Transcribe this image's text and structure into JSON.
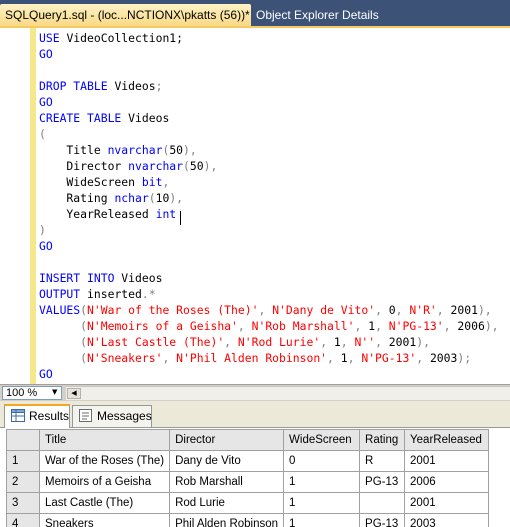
{
  "tabs": {
    "active_label": "SQLQuery1.sql - (loc...NCTIONX\\pkatts (56))*",
    "inactive_label": "Object Explorer Details"
  },
  "editor": {
    "lines": [
      {
        "row": 0,
        "segs": [
          [
            "kw",
            "USE "
          ],
          [
            "",
            "VideoCollection1;"
          ]
        ]
      },
      {
        "row": 1,
        "segs": [
          [
            "kw",
            "GO"
          ]
        ]
      },
      {
        "row": 3,
        "segs": [
          [
            "kw",
            "DROP TABLE "
          ],
          [
            "",
            "Videos"
          ],
          [
            "op",
            ";"
          ]
        ]
      },
      {
        "row": 4,
        "segs": [
          [
            "kw",
            "GO"
          ]
        ]
      },
      {
        "row": 5,
        "segs": [
          [
            "kw",
            "CREATE TABLE "
          ],
          [
            "",
            "Videos"
          ]
        ]
      },
      {
        "row": 6,
        "segs": [
          [
            "op",
            "("
          ]
        ]
      },
      {
        "row": 7,
        "segs": [
          [
            "",
            "    Title "
          ],
          [
            "kw",
            "nvarchar"
          ],
          [
            "op",
            "("
          ],
          [
            "",
            "50"
          ],
          [
            "op",
            "),"
          ]
        ]
      },
      {
        "row": 8,
        "segs": [
          [
            "",
            "    Director "
          ],
          [
            "kw",
            "nvarchar"
          ],
          [
            "op",
            "("
          ],
          [
            "",
            "50"
          ],
          [
            "op",
            "),"
          ]
        ]
      },
      {
        "row": 9,
        "segs": [
          [
            "",
            "    WideScreen "
          ],
          [
            "kw",
            "bit"
          ],
          [
            "op",
            ","
          ]
        ]
      },
      {
        "row": 10,
        "segs": [
          [
            "",
            "    Rating "
          ],
          [
            "kw",
            "nchar"
          ],
          [
            "op",
            "("
          ],
          [
            "",
            "10"
          ],
          [
            "op",
            "),"
          ]
        ]
      },
      {
        "row": 11,
        "segs": [
          [
            "",
            "    YearReleased "
          ],
          [
            "kw",
            "int"
          ]
        ]
      },
      {
        "row": 12,
        "segs": [
          [
            "op",
            ")"
          ]
        ]
      },
      {
        "row": 13,
        "segs": [
          [
            "kw",
            "GO"
          ]
        ]
      },
      {
        "row": 15,
        "segs": [
          [
            "kw",
            "INSERT INTO "
          ],
          [
            "",
            "Videos"
          ]
        ]
      },
      {
        "row": 16,
        "segs": [
          [
            "kw",
            "OUTPUT "
          ],
          [
            "",
            "inserted"
          ],
          [
            "op",
            ".*"
          ]
        ]
      },
      {
        "row": 17,
        "segs": [
          [
            "kw",
            "VALUES"
          ],
          [
            "op",
            "("
          ],
          [
            "str",
            "N'War of the Roses (The)'"
          ],
          [
            "op",
            ", "
          ],
          [
            "str",
            "N'Dany de Vito'"
          ],
          [
            "op",
            ", "
          ],
          [
            "",
            "0"
          ],
          [
            "op",
            ", "
          ],
          [
            "str",
            "N'R'"
          ],
          [
            "op",
            ", "
          ],
          [
            "",
            "2001"
          ],
          [
            "op",
            "),"
          ]
        ]
      },
      {
        "row": 18,
        "segs": [
          [
            "",
            "      "
          ],
          [
            "op",
            "("
          ],
          [
            "str",
            "N'Memoirs of a Geisha'"
          ],
          [
            "op",
            ", "
          ],
          [
            "str",
            "N'Rob Marshall'"
          ],
          [
            "op",
            ", "
          ],
          [
            "",
            "1"
          ],
          [
            "op",
            ", "
          ],
          [
            "str",
            "N'PG-13'"
          ],
          [
            "op",
            ", "
          ],
          [
            "",
            "2006"
          ],
          [
            "op",
            "),"
          ]
        ]
      },
      {
        "row": 19,
        "segs": [
          [
            "",
            "      "
          ],
          [
            "op",
            "("
          ],
          [
            "str",
            "N'Last Castle (The)'"
          ],
          [
            "op",
            ", "
          ],
          [
            "str",
            "N'Rod Lurie'"
          ],
          [
            "op",
            ", "
          ],
          [
            "",
            "1"
          ],
          [
            "op",
            ", "
          ],
          [
            "str",
            "N''"
          ],
          [
            "op",
            ", "
          ],
          [
            "",
            "2001"
          ],
          [
            "op",
            "),"
          ]
        ]
      },
      {
        "row": 20,
        "segs": [
          [
            "",
            "      "
          ],
          [
            "op",
            "("
          ],
          [
            "str",
            "N'Sneakers'"
          ],
          [
            "op",
            ", "
          ],
          [
            "str",
            "N'Phil Alden Robinson'"
          ],
          [
            "op",
            ", "
          ],
          [
            "",
            "1"
          ],
          [
            "op",
            ", "
          ],
          [
            "str",
            "N'PG-13'"
          ],
          [
            "op",
            ", "
          ],
          [
            "",
            "2003"
          ],
          [
            "op",
            ");"
          ]
        ]
      },
      {
        "row": 21,
        "segs": [
          [
            "kw",
            "GO"
          ]
        ]
      }
    ]
  },
  "zoom": {
    "value": "100 %"
  },
  "results_tabs": {
    "results_label": "Results",
    "messages_label": "Messages"
  },
  "grid": {
    "columns": [
      "Title",
      "Director",
      "WideScreen",
      "Rating",
      "YearReleased"
    ],
    "rows": [
      {
        "n": "1",
        "cells": [
          "War of the Roses (The)",
          "Dany de Vito",
          "0",
          "R",
          "2001"
        ]
      },
      {
        "n": "2",
        "cells": [
          "Memoirs of a Geisha",
          "Rob Marshall",
          "1",
          "PG-13",
          "2006"
        ]
      },
      {
        "n": "3",
        "cells": [
          "Last Castle (The)",
          "Rod Lurie",
          "1",
          "",
          "2001"
        ]
      },
      {
        "n": "4",
        "cells": [
          "Sneakers",
          "Phil Alden Robinson",
          "1",
          "PG-13",
          "2003"
        ]
      }
    ]
  },
  "colors": {
    "keyword": "#0000ff",
    "string": "#ff0000",
    "operator": "#808080",
    "tab_strip": "#3d5277",
    "active_tab": "#f8d985"
  }
}
